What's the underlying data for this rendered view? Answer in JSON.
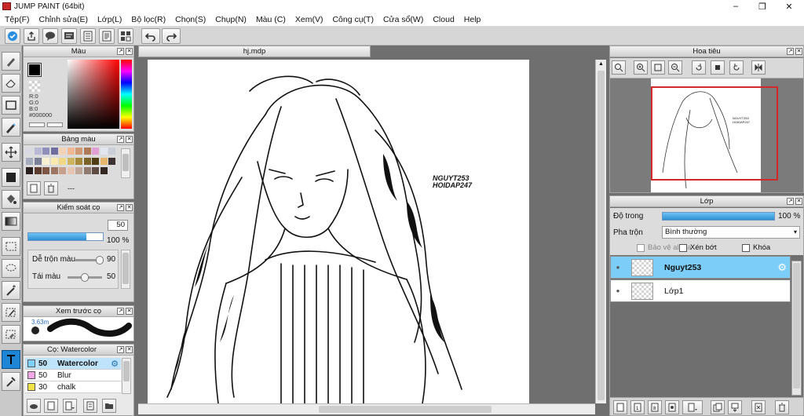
{
  "window": {
    "title": "JUMP PAINT (64bit)",
    "minimize": "–",
    "maximize": "❐",
    "close": "✕"
  },
  "menu": [
    "Tệp(F)",
    "Chỉnh sửa(E)",
    "Lớp(L)",
    "Bộ lọc(R)",
    "Chọn(S)",
    "Chụp(N)",
    "Màu (C)",
    "Xem(V)",
    "Công cụ(T)",
    "Cửa sổ(W)",
    "Cloud",
    "Help"
  ],
  "document": {
    "tab": "hj.mdp",
    "watermark_line1": "NGUYT253",
    "watermark_line2": "HOIDAP247"
  },
  "color_panel": {
    "title": "Màu",
    "r": "R:0",
    "g": "G:0",
    "b": "B:0",
    "hex": "#000000",
    "color": "#000000"
  },
  "palette_panel": {
    "title": "Bảng màu",
    "swatches": [
      "#d9d9e3",
      "#b9b9d6",
      "#8f8fbb",
      "#6f6f9f",
      "#f3d2b7",
      "#f0b894",
      "#cf9a74",
      "#b07957",
      "#e1a0d4",
      "#e3e6ef",
      "#c9ced9",
      "#a6acc0",
      "#7b8199",
      "#faf0d2",
      "#fbeab0",
      "#f1d884",
      "#cdb560",
      "#a58a3e",
      "#7a6327",
      "#4d3c14",
      "#e6b66c",
      "#3d3232",
      "#2a1f1f",
      "#5a3b2c",
      "#7f5645",
      "#9e7562",
      "#c79f8a",
      "#e7c5b2",
      "#bea79a",
      "#8f7a6f",
      "#5e4b43",
      "#322620"
    ],
    "dashes": "---"
  },
  "brush_control": {
    "title": "Kiểm soát cọ",
    "size": "50",
    "size_fill": 0.78,
    "opacity": "100 %",
    "opacity_fill": 1.0,
    "mix_label": "Dễ trộn màu",
    "mix_value": "90",
    "mix_level": 0.9,
    "resupply_label": "Tái màu",
    "resupply_value": "50",
    "resupply_level": 0.5
  },
  "preview_panel": {
    "title": "Xem trước cọ",
    "size_text": "3.63m"
  },
  "brush_list": {
    "title": "Cọ: Watercolor",
    "items": [
      {
        "size": "50",
        "name": "Watercolor",
        "color": "#7fd0ff",
        "selected": true
      },
      {
        "size": "50",
        "name": "Blur",
        "color": "#f2a6e6",
        "selected": false
      },
      {
        "size": "30",
        "name": "chalk",
        "color": "#f3e14a",
        "selected": false
      }
    ]
  },
  "navigator": {
    "title": "Hoa tiêu"
  },
  "layers": {
    "title": "Lớp",
    "opacity_label": "Độ trong",
    "opacity_value": "100 %",
    "opacity_fill": 1.0,
    "blend_label": "Pha trộn",
    "blend_value": "Bình thường",
    "protect_alpha": "Bảo vệ alpha",
    "clipping": "Xén bớt",
    "lock": "Khóa",
    "items": [
      {
        "name": "Nguyt253",
        "selected": true
      },
      {
        "name": "Lớp1",
        "selected": false
      }
    ]
  }
}
